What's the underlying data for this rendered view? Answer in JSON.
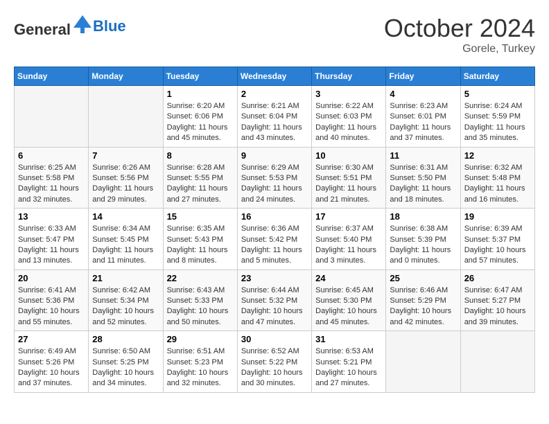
{
  "header": {
    "logo_general": "General",
    "logo_blue": "Blue",
    "month": "October 2024",
    "location": "Gorele, Turkey"
  },
  "days_of_week": [
    "Sunday",
    "Monday",
    "Tuesday",
    "Wednesday",
    "Thursday",
    "Friday",
    "Saturday"
  ],
  "weeks": [
    [
      {
        "day": "",
        "info": ""
      },
      {
        "day": "",
        "info": ""
      },
      {
        "day": "1",
        "sunrise": "6:20 AM",
        "sunset": "6:06 PM",
        "daylight": "11 hours and 45 minutes."
      },
      {
        "day": "2",
        "sunrise": "6:21 AM",
        "sunset": "6:04 PM",
        "daylight": "11 hours and 43 minutes."
      },
      {
        "day": "3",
        "sunrise": "6:22 AM",
        "sunset": "6:03 PM",
        "daylight": "11 hours and 40 minutes."
      },
      {
        "day": "4",
        "sunrise": "6:23 AM",
        "sunset": "6:01 PM",
        "daylight": "11 hours and 37 minutes."
      },
      {
        "day": "5",
        "sunrise": "6:24 AM",
        "sunset": "5:59 PM",
        "daylight": "11 hours and 35 minutes."
      }
    ],
    [
      {
        "day": "6",
        "sunrise": "6:25 AM",
        "sunset": "5:58 PM",
        "daylight": "11 hours and 32 minutes."
      },
      {
        "day": "7",
        "sunrise": "6:26 AM",
        "sunset": "5:56 PM",
        "daylight": "11 hours and 29 minutes."
      },
      {
        "day": "8",
        "sunrise": "6:28 AM",
        "sunset": "5:55 PM",
        "daylight": "11 hours and 27 minutes."
      },
      {
        "day": "9",
        "sunrise": "6:29 AM",
        "sunset": "5:53 PM",
        "daylight": "11 hours and 24 minutes."
      },
      {
        "day": "10",
        "sunrise": "6:30 AM",
        "sunset": "5:51 PM",
        "daylight": "11 hours and 21 minutes."
      },
      {
        "day": "11",
        "sunrise": "6:31 AM",
        "sunset": "5:50 PM",
        "daylight": "11 hours and 18 minutes."
      },
      {
        "day": "12",
        "sunrise": "6:32 AM",
        "sunset": "5:48 PM",
        "daylight": "11 hours and 16 minutes."
      }
    ],
    [
      {
        "day": "13",
        "sunrise": "6:33 AM",
        "sunset": "5:47 PM",
        "daylight": "11 hours and 13 minutes."
      },
      {
        "day": "14",
        "sunrise": "6:34 AM",
        "sunset": "5:45 PM",
        "daylight": "11 hours and 11 minutes."
      },
      {
        "day": "15",
        "sunrise": "6:35 AM",
        "sunset": "5:43 PM",
        "daylight": "11 hours and 8 minutes."
      },
      {
        "day": "16",
        "sunrise": "6:36 AM",
        "sunset": "5:42 PM",
        "daylight": "11 hours and 5 minutes."
      },
      {
        "day": "17",
        "sunrise": "6:37 AM",
        "sunset": "5:40 PM",
        "daylight": "11 hours and 3 minutes."
      },
      {
        "day": "18",
        "sunrise": "6:38 AM",
        "sunset": "5:39 PM",
        "daylight": "11 hours and 0 minutes."
      },
      {
        "day": "19",
        "sunrise": "6:39 AM",
        "sunset": "5:37 PM",
        "daylight": "10 hours and 57 minutes."
      }
    ],
    [
      {
        "day": "20",
        "sunrise": "6:41 AM",
        "sunset": "5:36 PM",
        "daylight": "10 hours and 55 minutes."
      },
      {
        "day": "21",
        "sunrise": "6:42 AM",
        "sunset": "5:34 PM",
        "daylight": "10 hours and 52 minutes."
      },
      {
        "day": "22",
        "sunrise": "6:43 AM",
        "sunset": "5:33 PM",
        "daylight": "10 hours and 50 minutes."
      },
      {
        "day": "23",
        "sunrise": "6:44 AM",
        "sunset": "5:32 PM",
        "daylight": "10 hours and 47 minutes."
      },
      {
        "day": "24",
        "sunrise": "6:45 AM",
        "sunset": "5:30 PM",
        "daylight": "10 hours and 45 minutes."
      },
      {
        "day": "25",
        "sunrise": "6:46 AM",
        "sunset": "5:29 PM",
        "daylight": "10 hours and 42 minutes."
      },
      {
        "day": "26",
        "sunrise": "6:47 AM",
        "sunset": "5:27 PM",
        "daylight": "10 hours and 39 minutes."
      }
    ],
    [
      {
        "day": "27",
        "sunrise": "6:49 AM",
        "sunset": "5:26 PM",
        "daylight": "10 hours and 37 minutes."
      },
      {
        "day": "28",
        "sunrise": "6:50 AM",
        "sunset": "5:25 PM",
        "daylight": "10 hours and 34 minutes."
      },
      {
        "day": "29",
        "sunrise": "6:51 AM",
        "sunset": "5:23 PM",
        "daylight": "10 hours and 32 minutes."
      },
      {
        "day": "30",
        "sunrise": "6:52 AM",
        "sunset": "5:22 PM",
        "daylight": "10 hours and 30 minutes."
      },
      {
        "day": "31",
        "sunrise": "6:53 AM",
        "sunset": "5:21 PM",
        "daylight": "10 hours and 27 minutes."
      },
      {
        "day": "",
        "info": ""
      },
      {
        "day": "",
        "info": ""
      }
    ]
  ]
}
